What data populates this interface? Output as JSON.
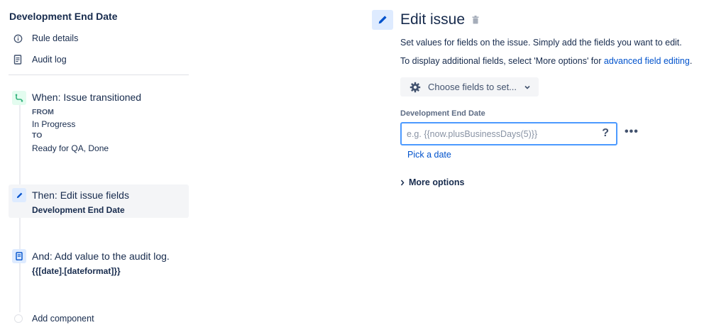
{
  "sidebar": {
    "rule_title": "Development End Date",
    "nav": [
      {
        "label": "Rule details",
        "icon": "info-icon"
      },
      {
        "label": "Audit log",
        "icon": "document-icon"
      }
    ],
    "components": [
      {
        "title": "When: Issue transitioned",
        "icon": "transition-icon",
        "from_label": "FROM",
        "from_value": "In Progress",
        "to_label": "TO",
        "to_value": "Ready for QA, Done"
      },
      {
        "title": "Then: Edit issue fields",
        "icon": "pencil-icon",
        "detail": "Development End Date"
      },
      {
        "title": "And: Add value to the audit log.",
        "icon": "log-icon",
        "detail": "{{[date].[dateformat]}}"
      }
    ],
    "add_component": "Add component"
  },
  "editor": {
    "title": "Edit issue",
    "description": "Set values for fields on the issue. Simply add the fields you want to edit.",
    "additional_prefix": "To display additional fields, select 'More options' for ",
    "additional_link": "advanced field editing",
    "additional_suffix": ".",
    "choose_fields": "Choose fields to set...",
    "field_label": "Development End Date",
    "field_value": "",
    "field_placeholder": "e.g. {{now.plusBusinessDays(5)}}",
    "help_glyph": "?",
    "more_glyph": "•••",
    "pick_date": "Pick a date",
    "more_options": "More options"
  },
  "colors": {
    "accent": "#0052cc",
    "trigger_green": "#36b37e",
    "action_blue": "#0052cc",
    "selected_bg": "#f4f5f7"
  }
}
